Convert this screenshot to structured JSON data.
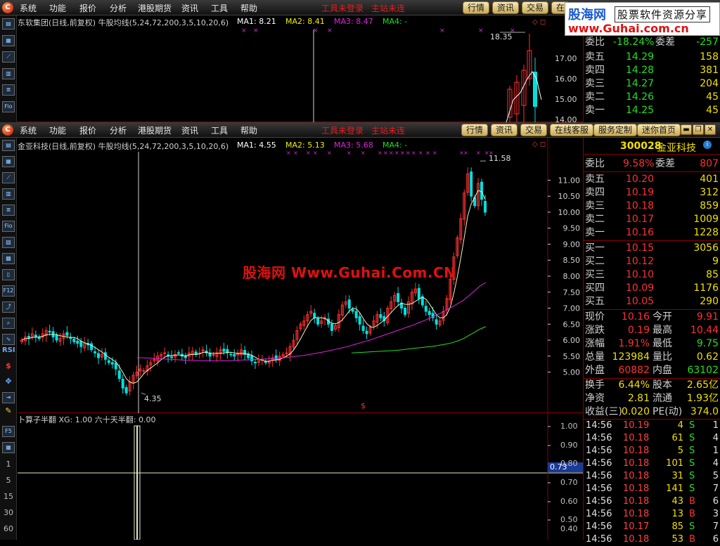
{
  "menu": {
    "items": [
      "系统",
      "功能",
      "报价",
      "分析",
      "港股期货",
      "资讯",
      "工具",
      "帮助"
    ],
    "notice": [
      "工具未登录",
      "主站未连"
    ]
  },
  "buttons_top": [
    "行情",
    "资讯",
    "交易",
    "在线客服",
    "服务定制",
    "迷你首页"
  ],
  "buttons_back": [
    "行情",
    "资讯",
    "交易",
    "在"
  ],
  "watermark": {
    "logo_main": "股海网",
    "logo_tag": "股票软件资源分享",
    "logo_url": "www.Guhai.com.cn",
    "center": "股海网 Www.Guhai.Com.CN"
  },
  "toolbar_left": [
    "1",
    "5",
    "15",
    "30",
    "60"
  ],
  "back_window": {
    "header": "东软集团(日线,前复权) 牛股均线(5,24,72,200,3,5,10,20,6)",
    "ma1": "MA1: 8.21",
    "ma2": "MA2: 8.41",
    "ma3": "MA3: 8.47",
    "ma4": "MA4: -",
    "peak_label": "18.35",
    "y_labels": [
      "17.00",
      "16.00",
      "15.00",
      "14.00"
    ],
    "quote_rows": [
      {
        "label": "委比",
        "price": "-18.24%",
        "label2": "委差",
        "vol": "-257"
      },
      {
        "label": "卖五",
        "price": "14.29",
        "vol": "158"
      },
      {
        "label": "卖四",
        "price": "14.28",
        "vol": "381"
      },
      {
        "label": "卖三",
        "price": "14.27",
        "vol": "204"
      },
      {
        "label": "卖二",
        "price": "14.26",
        "vol": "45"
      },
      {
        "label": "卖一",
        "price": "14.25",
        "vol": "45"
      }
    ]
  },
  "main_chart": {
    "header": "金亚科技(日线,前复权) 牛股均线(5,24,72,200,3,5,10,20,6)",
    "ma1": "MA1: 4.55",
    "ma2": "MA2: 5.13",
    "ma3": "MA3: 5.68",
    "ma4": "MA4: -",
    "high_label": "11.58",
    "low_label": "4.35",
    "signal_mark": "$"
  },
  "indicator": {
    "header": "卜算子半翻 XG: 1.00 六十天半翻: 0.00",
    "current": "0.73",
    "y_labels": [
      "1.00",
      "0.90",
      "0.80",
      "0.70",
      "0.60",
      "0.50",
      "0.40"
    ]
  },
  "stock": {
    "code": "300028",
    "name": "金亚科技",
    "info_icon": "info-icon"
  },
  "order_book": [
    {
      "label": "委比",
      "price": "9.58%",
      "label2": "委差",
      "vol": "807"
    },
    {
      "label": "卖五",
      "price": "10.20",
      "vol": "401"
    },
    {
      "label": "卖四",
      "price": "10.19",
      "vol": "312"
    },
    {
      "label": "卖三",
      "price": "10.18",
      "vol": "859"
    },
    {
      "label": "卖二",
      "price": "10.17",
      "vol": "1009"
    },
    {
      "label": "卖一",
      "price": "10.16",
      "vol": "1228"
    },
    {
      "label": "买一",
      "price": "10.15",
      "vol": "3056"
    },
    {
      "label": "买二",
      "price": "10.12",
      "vol": "9"
    },
    {
      "label": "买三",
      "price": "10.10",
      "vol": "85"
    },
    {
      "label": "买四",
      "price": "10.09",
      "vol": "1176"
    },
    {
      "label": "买五",
      "price": "10.05",
      "vol": "290"
    }
  ],
  "stats": [
    {
      "l1": "现价",
      "v1": "10.16",
      "l2": "今开",
      "v2": "9.91"
    },
    {
      "l1": "涨跌",
      "v1": "0.19",
      "l2": "最高",
      "v2": "10.44"
    },
    {
      "l1": "涨幅",
      "v1": "1.91%",
      "l2": "最低",
      "v2": "9.75"
    },
    {
      "l1": "总量",
      "v1": "123984",
      "l2": "量比",
      "v2": "0.62"
    },
    {
      "l1": "外盘",
      "v1": "60882",
      "l2": "内盘",
      "v2": "63102"
    }
  ],
  "fundamentals": [
    {
      "l1": "换手",
      "v1": "6.44%",
      "l2": "股本",
      "v2": "2.65亿"
    },
    {
      "l1": "净资",
      "v1": "2.81",
      "l2": "流通",
      "v2": "1.93亿"
    },
    {
      "l1": "收益(三)",
      "v1": "0.020",
      "l2": "PE(动)",
      "v2": "374.0"
    }
  ],
  "ticks": [
    {
      "time": "14:56",
      "price": "10.19",
      "vol": "4",
      "bs": "S",
      "n": "1"
    },
    {
      "time": "14:56",
      "price": "10.18",
      "vol": "61",
      "bs": "S",
      "n": "4"
    },
    {
      "time": "14:56",
      "price": "10.18",
      "vol": "5",
      "bs": "S",
      "n": "1"
    },
    {
      "time": "14:56",
      "price": "10.18",
      "vol": "101",
      "bs": "S",
      "n": "4"
    },
    {
      "time": "14:56",
      "price": "10.18",
      "vol": "31",
      "bs": "S",
      "n": "5"
    },
    {
      "time": "14:56",
      "price": "10.18",
      "vol": "141",
      "bs": "S",
      "n": "7"
    },
    {
      "time": "14:56",
      "price": "10.18",
      "vol": "43",
      "bs": "B",
      "n": "6"
    },
    {
      "time": "14:56",
      "price": "10.18",
      "vol": "13",
      "bs": "B",
      "n": "3"
    },
    {
      "time": "14:56",
      "price": "10.17",
      "vol": "85",
      "bs": "S",
      "n": "7"
    },
    {
      "time": "14:56",
      "price": "10.18",
      "vol": "53",
      "bs": "B",
      "n": "6"
    }
  ],
  "chart_data": {
    "type": "candlestick",
    "ylim": [
      5.0,
      11.5
    ],
    "y_ticks": [
      "11.00",
      "10.50",
      "10.00",
      "9.50",
      "9.00",
      "8.50",
      "8.00",
      "7.50",
      "7.00",
      "6.50",
      "6.00",
      "5.50",
      "5.00"
    ],
    "close": [
      6.0,
      6.1,
      6.05,
      6.2,
      6.1,
      6.05,
      6.2,
      6.3,
      6.25,
      6.1,
      6.0,
      6.05,
      6.2,
      6.15,
      6.05,
      5.95,
      5.9,
      5.8,
      5.9,
      5.85,
      5.7,
      5.6,
      5.45,
      5.55,
      5.4,
      5.3,
      5.25,
      5.1,
      4.8,
      4.5,
      4.35,
      4.7,
      4.9,
      5.0,
      5.1,
      5.05,
      5.2,
      5.3,
      5.4,
      5.5,
      5.55,
      5.6,
      5.5,
      5.45,
      5.55,
      5.6,
      5.5,
      5.45,
      5.6,
      5.65,
      5.55,
      5.6,
      5.7,
      5.6,
      5.5,
      5.55,
      5.6,
      5.7,
      5.65,
      5.6,
      5.55,
      5.5,
      5.6,
      5.7,
      5.55,
      5.45,
      5.35,
      5.3,
      5.35,
      5.4,
      5.3,
      5.35,
      5.45,
      5.4,
      5.5,
      5.55,
      5.6,
      5.8,
      6.0,
      6.3,
      6.5,
      6.6,
      6.8,
      6.9,
      6.7,
      6.5,
      6.6,
      6.7,
      6.5,
      6.3,
      6.45,
      6.8,
      7.1,
      7.2,
      7.0,
      6.9,
      6.7,
      6.5,
      6.3,
      6.2,
      6.4,
      6.6,
      6.8,
      6.7,
      6.6,
      7.0,
      7.2,
      7.4,
      7.2,
      7.0,
      6.8,
      7.2,
      7.5,
      7.6,
      7.3,
      7.1,
      6.9,
      6.8,
      6.7,
      6.5,
      6.6,
      6.9,
      7.3,
      7.9,
      8.6,
      9.2,
      9.8,
      10.6,
      11.2,
      10.5,
      10.2,
      10.9,
      10.4,
      10.0
    ],
    "ma_slow": [
      5.45,
      5.45,
      5.44,
      5.43,
      5.42,
      5.41,
      5.4,
      5.39,
      5.38,
      5.37,
      5.37,
      5.36,
      5.36,
      5.36,
      5.35,
      5.35,
      5.36,
      5.36,
      5.37,
      5.38,
      5.38,
      5.39,
      5.4,
      5.41,
      5.42,
      5.43,
      5.44,
      5.46,
      5.48,
      5.5,
      5.52,
      5.55,
      5.58,
      5.61,
      5.64,
      5.68,
      5.72,
      5.76,
      5.8,
      5.85,
      5.9,
      5.95,
      6.0,
      6.06,
      6.12,
      6.18,
      6.24,
      6.3,
      6.36,
      6.42,
      6.48,
      6.55,
      6.62,
      6.7,
      6.78,
      6.86,
      6.95,
      7.05,
      7.15,
      7.25,
      7.4,
      7.55,
      7.7,
      7.8
    ],
    "ma_long": [
      5.6,
      5.61,
      5.62,
      5.63,
      5.64,
      5.65,
      5.66,
      5.67,
      5.68,
      5.7,
      5.72,
      5.74,
      5.76,
      5.78,
      5.8,
      5.82,
      5.85,
      5.88,
      5.92,
      5.98,
      6.05,
      6.15,
      6.25,
      6.35,
      6.42
    ]
  }
}
